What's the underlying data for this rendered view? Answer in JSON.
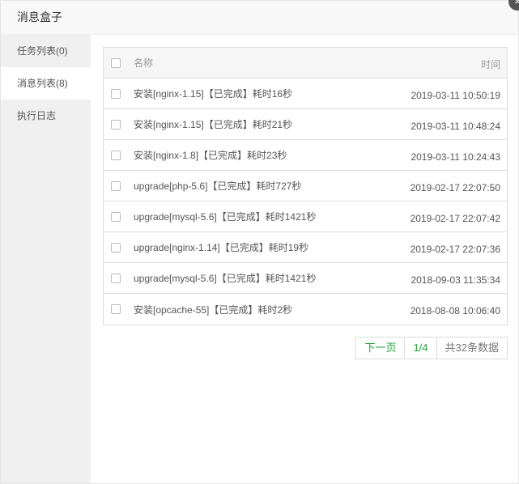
{
  "dialog": {
    "title": "消息盒子",
    "close_icon": "×"
  },
  "sidebar": {
    "items": [
      {
        "label": "任务列表(0)"
      },
      {
        "label": "消息列表(8)"
      },
      {
        "label": "执行日志"
      }
    ],
    "active_index": 1
  },
  "table": {
    "headers": {
      "name": "名称",
      "time": "时间"
    },
    "rows": [
      {
        "name": "安装[nginx-1.15]【已完成】耗时16秒",
        "time": "2019-03-11 10:50:19"
      },
      {
        "name": "安装[nginx-1.15]【已完成】耗时21秒",
        "time": "2019-03-11 10:48:24"
      },
      {
        "name": "安装[nginx-1.8]【已完成】耗时23秒",
        "time": "2019-03-11 10:24:43"
      },
      {
        "name": "upgrade[php-5.6]【已完成】耗时727秒",
        "time": "2019-02-17 22:07:50"
      },
      {
        "name": "upgrade[mysql-5.6]【已完成】耗时1421秒",
        "time": "2019-02-17 22:07:42"
      },
      {
        "name": "upgrade[nginx-1.14]【已完成】耗时19秒",
        "time": "2019-02-17 22:07:36"
      },
      {
        "name": "upgrade[mysql-5.6]【已完成】耗时1421秒",
        "time": "2018-09-03 11:35:34"
      },
      {
        "name": "安装[opcache-55]【已完成】耗时2秒",
        "time": "2018-08-08 10:06:40"
      }
    ]
  },
  "pager": {
    "next": "下一页",
    "page": "1/4",
    "total": "共32条数据"
  }
}
